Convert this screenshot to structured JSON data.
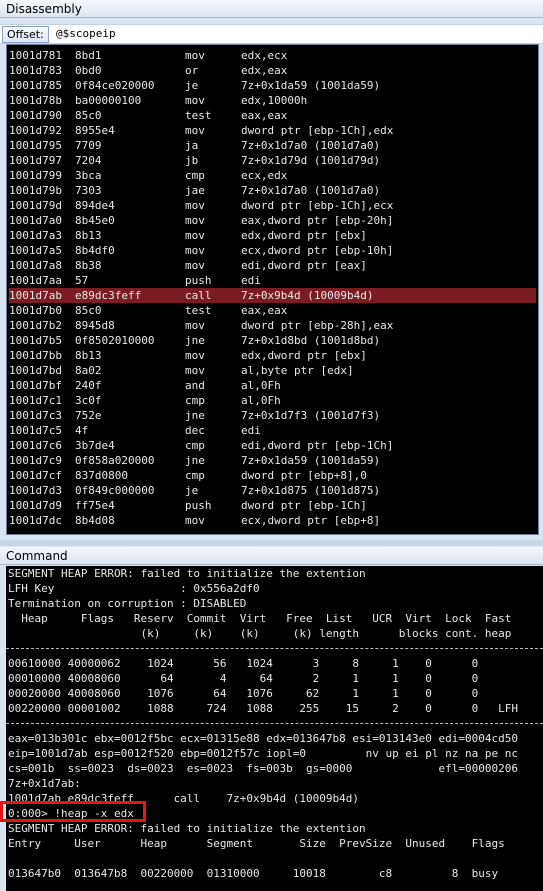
{
  "disassembly": {
    "title": "Disassembly",
    "offset_label": "Offset:",
    "offset_value": "@$scopeip",
    "rows": [
      {
        "addr": "1001d781",
        "bytes": "8bd1",
        "mn": "mov",
        "op": "edx,ecx"
      },
      {
        "addr": "1001d783",
        "bytes": "0bd0",
        "mn": "or",
        "op": "edx,eax"
      },
      {
        "addr": "1001d785",
        "bytes": "0f84ce020000",
        "mn": "je",
        "op": "7z+0x1da59 (1001da59)"
      },
      {
        "addr": "1001d78b",
        "bytes": "ba00000100",
        "mn": "mov",
        "op": "edx,10000h"
      },
      {
        "addr": "1001d790",
        "bytes": "85c0",
        "mn": "test",
        "op": "eax,eax"
      },
      {
        "addr": "1001d792",
        "bytes": "8955e4",
        "mn": "mov",
        "op": "dword ptr [ebp-1Ch],edx"
      },
      {
        "addr": "1001d795",
        "bytes": "7709",
        "mn": "ja",
        "op": "7z+0x1d7a0 (1001d7a0)"
      },
      {
        "addr": "1001d797",
        "bytes": "7204",
        "mn": "jb",
        "op": "7z+0x1d79d (1001d79d)"
      },
      {
        "addr": "1001d799",
        "bytes": "3bca",
        "mn": "cmp",
        "op": "ecx,edx"
      },
      {
        "addr": "1001d79b",
        "bytes": "7303",
        "mn": "jae",
        "op": "7z+0x1d7a0 (1001d7a0)"
      },
      {
        "addr": "1001d79d",
        "bytes": "894de4",
        "mn": "mov",
        "op": "dword ptr [ebp-1Ch],ecx"
      },
      {
        "addr": "1001d7a0",
        "bytes": "8b45e0",
        "mn": "mov",
        "op": "eax,dword ptr [ebp-20h]"
      },
      {
        "addr": "1001d7a3",
        "bytes": "8b13",
        "mn": "mov",
        "op": "edx,dword ptr [ebx]"
      },
      {
        "addr": "1001d7a5",
        "bytes": "8b4df0",
        "mn": "mov",
        "op": "ecx,dword ptr [ebp-10h]"
      },
      {
        "addr": "1001d7a8",
        "bytes": "8b38",
        "mn": "mov",
        "op": "edi,dword ptr [eax]"
      },
      {
        "addr": "1001d7aa",
        "bytes": "57",
        "mn": "push",
        "op": "edi"
      },
      {
        "addr": "1001d7ab",
        "bytes": "e89dc3feff",
        "mn": "call",
        "op": "7z+0x9b4d (10009b4d)",
        "highlight": true
      },
      {
        "addr": "1001d7b0",
        "bytes": "85c0",
        "mn": "test",
        "op": "eax,eax"
      },
      {
        "addr": "1001d7b2",
        "bytes": "8945d8",
        "mn": "mov",
        "op": "dword ptr [ebp-28h],eax"
      },
      {
        "addr": "1001d7b5",
        "bytes": "0f8502010000",
        "mn": "jne",
        "op": "7z+0x1d8bd (1001d8bd)"
      },
      {
        "addr": "1001d7bb",
        "bytes": "8b13",
        "mn": "mov",
        "op": "edx,dword ptr [ebx]"
      },
      {
        "addr": "1001d7bd",
        "bytes": "8a02",
        "mn": "mov",
        "op": "al,byte ptr [edx]"
      },
      {
        "addr": "1001d7bf",
        "bytes": "240f",
        "mn": "and",
        "op": "al,0Fh"
      },
      {
        "addr": "1001d7c1",
        "bytes": "3c0f",
        "mn": "cmp",
        "op": "al,0Fh"
      },
      {
        "addr": "1001d7c3",
        "bytes": "752e",
        "mn": "jne",
        "op": "7z+0x1d7f3 (1001d7f3)"
      },
      {
        "addr": "1001d7c5",
        "bytes": "4f",
        "mn": "dec",
        "op": "edi"
      },
      {
        "addr": "1001d7c6",
        "bytes": "3b7de4",
        "mn": "cmp",
        "op": "edi,dword ptr [ebp-1Ch]"
      },
      {
        "addr": "1001d7c9",
        "bytes": "0f858a020000",
        "mn": "jne",
        "op": "7z+0x1da59 (1001da59)"
      },
      {
        "addr": "1001d7cf",
        "bytes": "837d0800",
        "mn": "cmp",
        "op": "dword ptr [ebp+8],0"
      },
      {
        "addr": "1001d7d3",
        "bytes": "0f849c000000",
        "mn": "je",
        "op": "7z+0x1d875 (1001d875)"
      },
      {
        "addr": "1001d7d9",
        "bytes": "ff75e4",
        "mn": "push",
        "op": "dword ptr [ebp-1Ch]"
      },
      {
        "addr": "1001d7dc",
        "bytes": "8b4d08",
        "mn": "mov",
        "op": "ecx,dword ptr [ebp+8]"
      }
    ]
  },
  "command": {
    "title": "Command",
    "lines": [
      "SEGMENT HEAP ERROR: failed to initialize the extention",
      "LFH Key                   : 0x556a2df0",
      "Termination on corruption : DISABLED",
      "  Heap     Flags   Reserv  Commit  Virt   Free  List   UCR  Virt  Lock  Fast",
      "                    (k)     (k)    (k)     (k) length      blocks cont. heap",
      "",
      "00610000 40000062    1024      56   1024      3     8     1    0      0",
      "00010000 40008060      64       4     64      2     1     1    0      0",
      "00020000 40008060    1076      64   1076     62     1     1    0      0",
      "00220000 00001002    1088     724   1088    255    15     2    0      0   LFH",
      "",
      "eax=013b301c ebx=0012f5bc ecx=01315e88 edx=013647b8 esi=013143e0 edi=0004cd50",
      "eip=1001d7ab esp=0012f520 ebp=0012f57c iopl=0         nv up ei pl nz na pe nc",
      "cs=001b  ss=0023  ds=0023  es=0023  fs=003b  gs=0000             efl=00000206",
      "7z+0x1d7ab:",
      "1001d7ab e89dc3feff      call    7z+0x9b4d (10009b4d)",
      "0:000> !heap -x edx",
      "SEGMENT HEAP ERROR: failed to initialize the extention",
      "Entry     User      Heap      Segment       Size  PrevSize  Unused    Flags",
      "",
      "013647b0  013647b8  00220000  01310000     10018        c8         8  busy"
    ]
  }
}
